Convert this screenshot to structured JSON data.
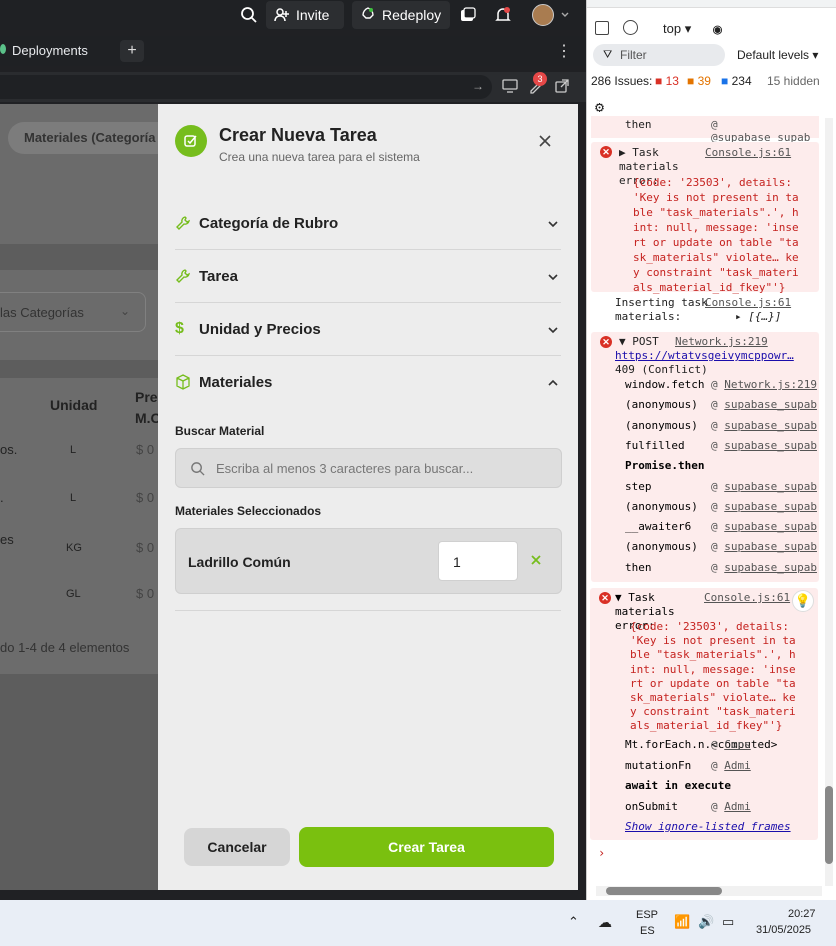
{
  "topbar": {
    "invite_label": "Invite",
    "redeploy_label": "Redeploy"
  },
  "tabs": {
    "deployments_label": "Deployments"
  },
  "addrbar": {
    "ext_badge": "3"
  },
  "background": {
    "breadcrumb_partial": "Materiales (Categoría",
    "filter_partial": "las Categorías",
    "col_unidad": "Unidad",
    "col_precio_partial": "Prec M.C",
    "rows": [
      {
        "name": "os.",
        "unit": "L",
        "price": "$ 0"
      },
      {
        "name": ".",
        "unit": "L",
        "price": "$ 0"
      },
      {
        "name": "es",
        "unit": "KG",
        "price": "$ 0"
      },
      {
        "name": "",
        "unit": "GL",
        "price": "$ 0"
      }
    ],
    "pagination_partial": "do 1-4 de 4 elementos"
  },
  "modal": {
    "title": "Crear Nueva Tarea",
    "subtitle": "Crea una nueva tarea para el sistema",
    "sections": [
      {
        "label": "Categoría de Rubro",
        "icon": "wrench-icon"
      },
      {
        "label": "Tarea",
        "icon": "wrench-icon"
      },
      {
        "label": "Unidad y Precios",
        "icon": "dollar-icon"
      },
      {
        "label": "Materiales",
        "icon": "cube-icon"
      }
    ],
    "search_label": "Buscar Material",
    "search_placeholder": "Escriba al menos 3 caracteres para buscar...",
    "selected_label": "Materiales Seleccionados",
    "selected_material": "Ladrillo Común",
    "selected_qty": "1",
    "cancel_label": "Cancelar",
    "create_label": "Crear Tarea",
    "accent": "#76bd1d"
  },
  "devtools": {
    "context": "top",
    "filter_placeholder": "Filter",
    "levels": "Default levels",
    "issues_total": "286 Issues:",
    "issues_err": "13",
    "issues_warn": "39",
    "issues_info": "234",
    "issues_hidden": "15 hidden",
    "top_then": "then",
    "top_then_src": "@supabase_supab",
    "err1_head": "Task materials error:",
    "err1_src": "Console.js:61",
    "err_obj_lines": [
      "{code: '23503', details:",
      "'Key is not present in ta",
      "ble \"task_materials\".', h",
      "int: null, message: 'inse",
      "rt or update on table \"ta",
      "sk_materials\" violate… ke",
      "y constraint \"task_materi",
      "als_material_id_fkey\"'}"
    ],
    "insert_head": "Inserting task materials:",
    "insert_src": "Console.js:61",
    "insert_val": "[{…}]",
    "post_head": "POST",
    "post_src": "Network.js:219",
    "post_url": "https://wtatvsgeivymcppowr…",
    "post_status": "409 (Conflict)",
    "stack1": [
      {
        "fn": "window.fetch",
        "src": "@ Network.js:219"
      },
      {
        "fn": "(anonymous)",
        "src": "@ supabase_supab"
      },
      {
        "fn": "(anonymous)",
        "src": "@ supabase_supab"
      },
      {
        "fn": "fulfilled",
        "src": "@ supabase_supab"
      },
      {
        "fn": "Promise.then",
        "src": ""
      },
      {
        "fn": "step",
        "src": "@ supabase_supab"
      },
      {
        "fn": "(anonymous)",
        "src": "@ supabase_supab"
      },
      {
        "fn": "__awaiter6",
        "src": "@ supabase_supab"
      },
      {
        "fn": "(anonymous)",
        "src": "@ supabase_supab"
      },
      {
        "fn": "then",
        "src": "@ supabase_supab"
      }
    ],
    "err2_head": "Task materials error:",
    "err2_src": "Console.js:61",
    "stack2": [
      {
        "fn": "Mt.forEach.n.<computed>",
        "src": "@ Cons"
      },
      {
        "fn": "mutationFn",
        "src": "@ Admi"
      },
      {
        "fn": "await in execute",
        "src": ""
      },
      {
        "fn": "onSubmit",
        "src": "@ Admi"
      }
    ],
    "ignore_link": "Show ignore-listed frames"
  },
  "taskbar": {
    "lang": "ESP",
    "lang_sub": "ES",
    "time": "20:27",
    "date": "31/05/2025"
  }
}
